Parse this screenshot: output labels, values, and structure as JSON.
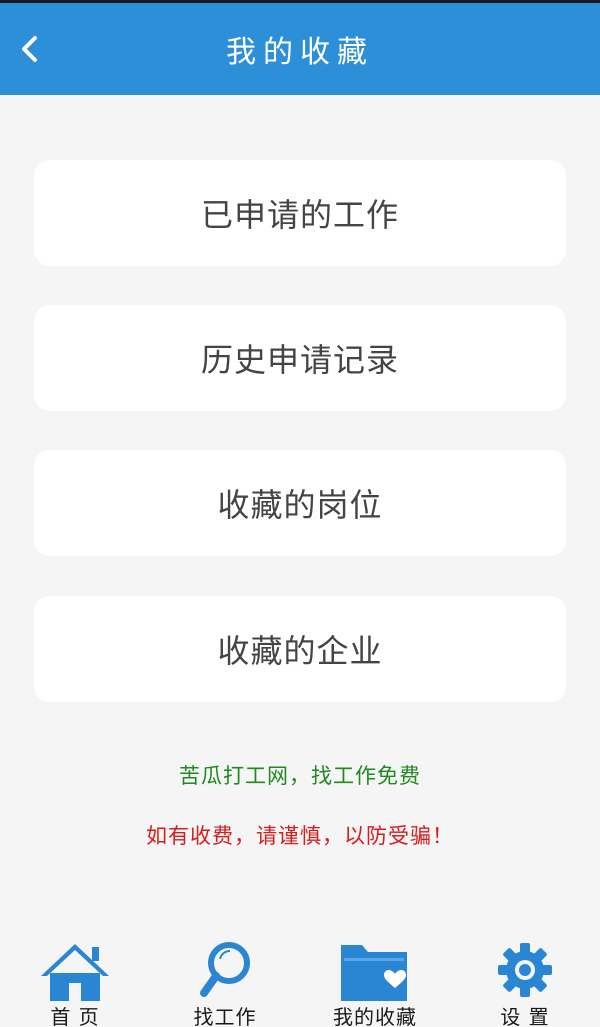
{
  "header": {
    "title": "我的收藏",
    "back_icon": "chevron-left-icon"
  },
  "menu": {
    "items": [
      {
        "label": "已申请的工作"
      },
      {
        "label": "历史申请记录"
      },
      {
        "label": "收藏的岗位"
      },
      {
        "label": "收藏的企业"
      }
    ]
  },
  "notices": {
    "slogan": "苦瓜打工网，找工作免费",
    "warning": "如有收费，请谨慎，以防受骗！"
  },
  "tabbar": {
    "tabs": [
      {
        "label": "首 页",
        "icon": "home-icon"
      },
      {
        "label": "找工作",
        "icon": "search-icon"
      },
      {
        "label": "我的收藏",
        "icon": "folder-heart-icon"
      },
      {
        "label": "设 置",
        "icon": "gear-icon"
      }
    ]
  },
  "colors": {
    "header_bg": "#2e8fd9",
    "icon_blue": "#2a85d3",
    "slogan_green": "#1f8a1f",
    "warning_red": "#d41e1e",
    "page_bg": "#f5f5f5"
  }
}
